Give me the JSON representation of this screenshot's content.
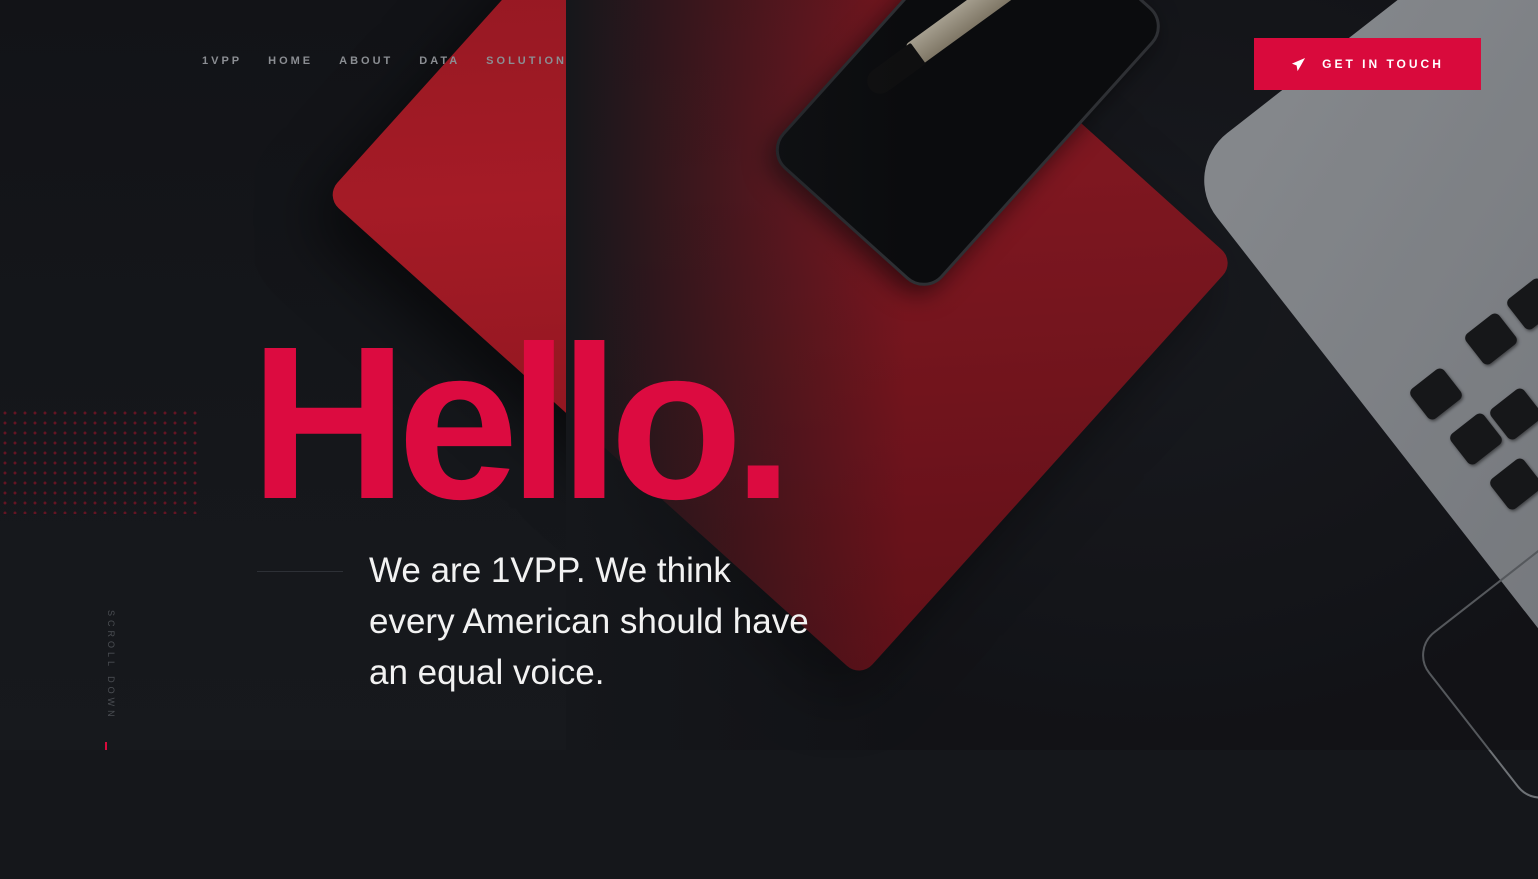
{
  "nav": {
    "items": [
      {
        "label": "1VPP"
      },
      {
        "label": "HOME"
      },
      {
        "label": "ABOUT"
      },
      {
        "label": "DATA"
      },
      {
        "label": "SOLUTION"
      }
    ]
  },
  "cta": {
    "label": "GET IN TOUCH",
    "icon": "paper-plane-icon"
  },
  "hero": {
    "title": "Hello.",
    "tagline": "We are 1VPP. We think every American should have an equal voice."
  },
  "scroll": {
    "label": "SCROLL DOWN"
  },
  "colors": {
    "accent": "#d90a3c",
    "background": "#15171b"
  }
}
